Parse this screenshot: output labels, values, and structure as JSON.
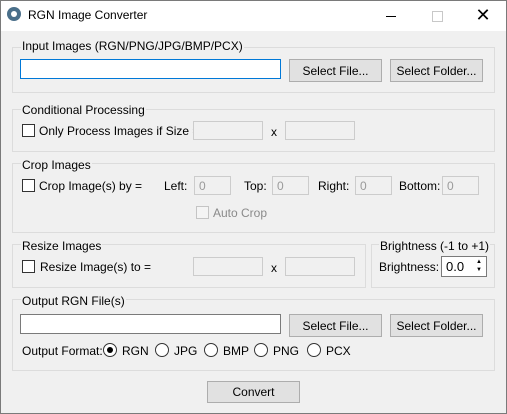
{
  "window": {
    "title": "RGN Image Converter"
  },
  "input": {
    "legend": "Input Images (RGN/PNG/JPG/BMP/PCX)",
    "path_value": "",
    "select_file": "Select File...",
    "select_folder": "Select Folder..."
  },
  "conditional": {
    "legend": "Conditional Processing",
    "checkbox_label": "Only Process Images if Size =",
    "checked": false,
    "width": "",
    "x_label": "x",
    "height": ""
  },
  "crop": {
    "legend": "Crop Images",
    "checkbox_label": "Crop Image(s) by =",
    "checked": false,
    "left_label": "Left:",
    "left_value": "0",
    "top_label": "Top:",
    "top_value": "0",
    "right_label": "Right:",
    "right_value": "0",
    "bottom_label": "Bottom:",
    "bottom_value": "0",
    "auto_crop_label": "Auto Crop",
    "auto_crop_checked": false
  },
  "resize": {
    "legend": "Resize Images",
    "checkbox_label": "Resize Image(s) to =",
    "checked": false,
    "width": "",
    "x_label": "x",
    "height": ""
  },
  "brightness": {
    "legend": "Brightness (-1 to +1)",
    "label": "Brightness:",
    "value": "0.0"
  },
  "output": {
    "legend": "Output RGN File(s)",
    "path_value": "",
    "select_file": "Select File...",
    "select_folder": "Select Folder...",
    "format_label": "Output Format:",
    "formats": [
      "RGN",
      "JPG",
      "BMP",
      "PNG",
      "PCX"
    ],
    "selected_format": "RGN"
  },
  "convert_label": "Convert"
}
